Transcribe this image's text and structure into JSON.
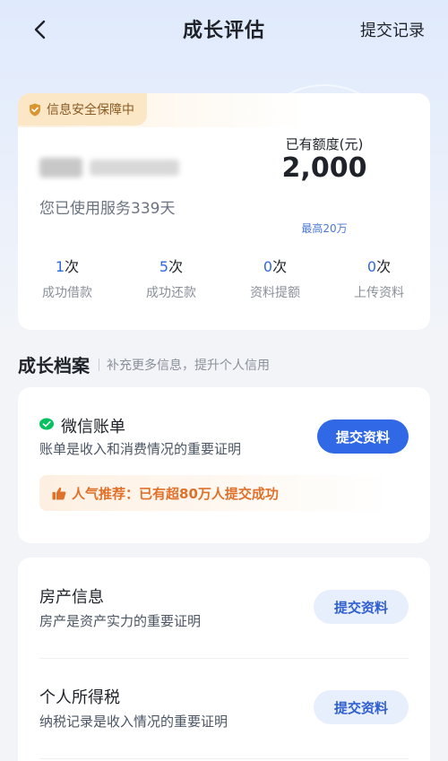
{
  "nav": {
    "title": "成长评估",
    "right_link": "提交记录",
    "back_icon": "chevron-left-icon"
  },
  "quota_card": {
    "security_tag": "信息安全保障中",
    "usage_text": "您已使用服务339天",
    "gauge": {
      "label": "已有额度(元)",
      "value": "2,000",
      "max_label": "最高20万",
      "fill_fraction": 0.1
    },
    "stats": [
      {
        "count": "1",
        "unit": "次",
        "label": "成功借款"
      },
      {
        "count": "5",
        "unit": "次",
        "label": "成功还款"
      },
      {
        "count": "0",
        "unit": "次",
        "label": "资料提额"
      },
      {
        "count": "0",
        "unit": "次",
        "label": "上传资料"
      }
    ]
  },
  "profile_section": {
    "title": "成长档案",
    "subtitle": "补充更多信息，提升个人信用",
    "wechat": {
      "title": "微信账单",
      "desc": "账单是收入和消费情况的重要证明",
      "button": "提交资料",
      "promo": "人气推荐：已有超80万人提交成功"
    },
    "items": [
      {
        "title": "房产信息",
        "desc": "房产是资产实力的重要证明",
        "button": "提交资料"
      },
      {
        "title": "个人所得税",
        "desc": "纳税记录是收入情况的重要证明",
        "button": "提交资料"
      }
    ]
  },
  "colors": {
    "primary": "#3068e6",
    "accent_orange": "#e0712a",
    "wechat_green": "#07c160"
  }
}
